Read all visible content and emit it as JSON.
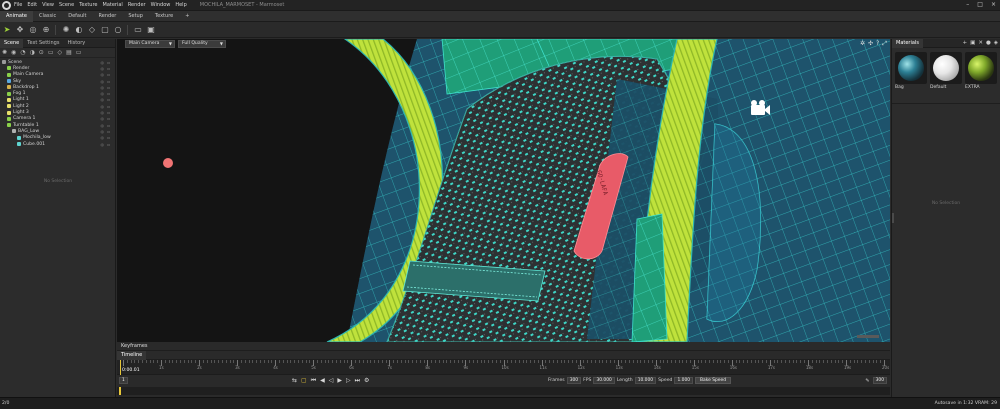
{
  "app": {
    "title": "MOCHILA_MARMOSET - Marmoset",
    "menus": [
      "File",
      "Edit",
      "View",
      "Scene",
      "Texture",
      "Material",
      "Render",
      "Window",
      "Help"
    ]
  },
  "mode_tabs": [
    "Animate",
    "Classic",
    "Default",
    "Render",
    "Setup",
    "Texture",
    "+"
  ],
  "toolbar_icons": [
    "select-icon",
    "move-icon",
    "rotate-icon",
    "scale-icon",
    "light-icon",
    "camera-icon",
    "shape-icon",
    "box-icon",
    "sphere-icon",
    "folder-icon",
    "save-icon"
  ],
  "left_panel": {
    "tabs": [
      "Scene",
      "Text Settings",
      "History"
    ],
    "nodes": [
      {
        "label": "Scene",
        "indent": 0,
        "color": "#9a9a9a"
      },
      {
        "label": "Render",
        "indent": 1,
        "color": "#8ad04a"
      },
      {
        "label": "Main Camera",
        "indent": 1,
        "color": "#8ad04a"
      },
      {
        "label": "Sky",
        "indent": 1,
        "color": "#5aa9e0"
      },
      {
        "label": "Backdrop 1",
        "indent": 1,
        "color": "#d8b34a"
      },
      {
        "label": "Fog 1",
        "indent": 1,
        "color": "#8ad04a"
      },
      {
        "label": "Light 1",
        "indent": 1,
        "color": "#e8e06a"
      },
      {
        "label": "Light 2",
        "indent": 1,
        "color": "#e8e06a"
      },
      {
        "label": "Light 3",
        "indent": 1,
        "color": "#e8e06a"
      },
      {
        "label": "Camera 1",
        "indent": 1,
        "color": "#8ad04a"
      },
      {
        "label": "Turntable 1",
        "indent": 1,
        "color": "#8ad04a"
      },
      {
        "label": "BAG_Low",
        "indent": 2,
        "color": "#b0b0b0"
      },
      {
        "label": "Mochila_low",
        "indent": 3,
        "color": "#5fd4d0"
      },
      {
        "label": "Cube.001",
        "indent": 3,
        "color": "#5fd4d0"
      }
    ],
    "no_selection": "No Selection"
  },
  "viewport": {
    "camera": "Main Camera",
    "quality": "Full Quality"
  },
  "right_panel": {
    "tab": "Materials",
    "materials": [
      {
        "name": "Bag",
        "style": "bag"
      },
      {
        "name": "Default",
        "style": "default"
      },
      {
        "name": "EXTRA",
        "style": "extra"
      }
    ],
    "no_selection": "No Selection"
  },
  "timeline": {
    "keyframes_tab": "Keyframes",
    "timeline_tab": "Timeline",
    "current_time": "0:00.01",
    "start": "1",
    "ruler_labels": [
      "1s",
      "2s",
      "3s",
      "4s",
      "5s",
      "6s",
      "7s",
      "8s",
      "9s",
      "10s",
      "11s",
      "12s",
      "13s",
      "14s",
      "15s",
      "16s",
      "17s",
      "18s",
      "19s",
      "20s"
    ],
    "frames_label": "Frames",
    "frames_value": "300",
    "fps_label": "FPS",
    "fps_value": "30.000",
    "length_label": "Length",
    "length_value": "10.000",
    "speed_label": "Speed",
    "speed_value": "1.000",
    "bake_label": "Bake Speed",
    "end_value": "300"
  },
  "status": {
    "left": "2/0",
    "right": "Autosave in 1:32   VRAM: 29"
  }
}
